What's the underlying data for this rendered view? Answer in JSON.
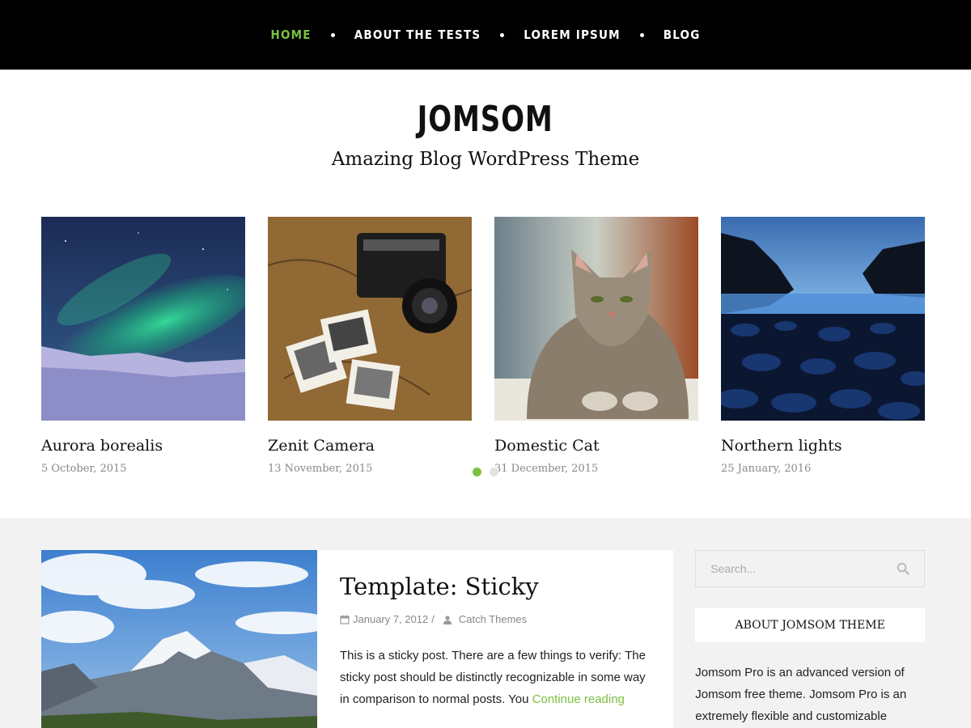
{
  "nav": {
    "items": [
      {
        "label": "HOME"
      },
      {
        "label": "ABOUT THE TESTS"
      },
      {
        "label": "LOREM IPSUM"
      },
      {
        "label": "BLOG"
      }
    ]
  },
  "header": {
    "title": "JOMSOM",
    "tagline": "Amazing Blog WordPress Theme"
  },
  "slider": {
    "slides": [
      {
        "title": "Aurora borealis",
        "date": "5 October, 2015"
      },
      {
        "title": "Zenit Camera",
        "date": "13 November, 2015"
      },
      {
        "title": "Domestic Cat",
        "date": "31 December, 2015"
      },
      {
        "title": "Northern lights",
        "date": "25 January, 2016"
      }
    ],
    "pages": 2,
    "active_page": 1
  },
  "post": {
    "title": "Template: Sticky",
    "date": "January 7, 2012",
    "separator": "/",
    "author": "Catch Themes",
    "excerpt": "This is a sticky post. There are a few things to verify: The sticky post should be distinctly recognizable in some way in comparison to normal posts. You",
    "read_more": "Continue reading"
  },
  "sidebar": {
    "search_placeholder": "Search...",
    "widget_title": "ABOUT JOMSOM THEME",
    "widget_text": "Jomsom Pro is an advanced version of Jomsom free theme. Jomsom Pro is an extremely flexible and customizable"
  },
  "colors": {
    "accent": "#7ac143",
    "nav_bg": "#000000",
    "content_bg": "#f2f2f2"
  }
}
